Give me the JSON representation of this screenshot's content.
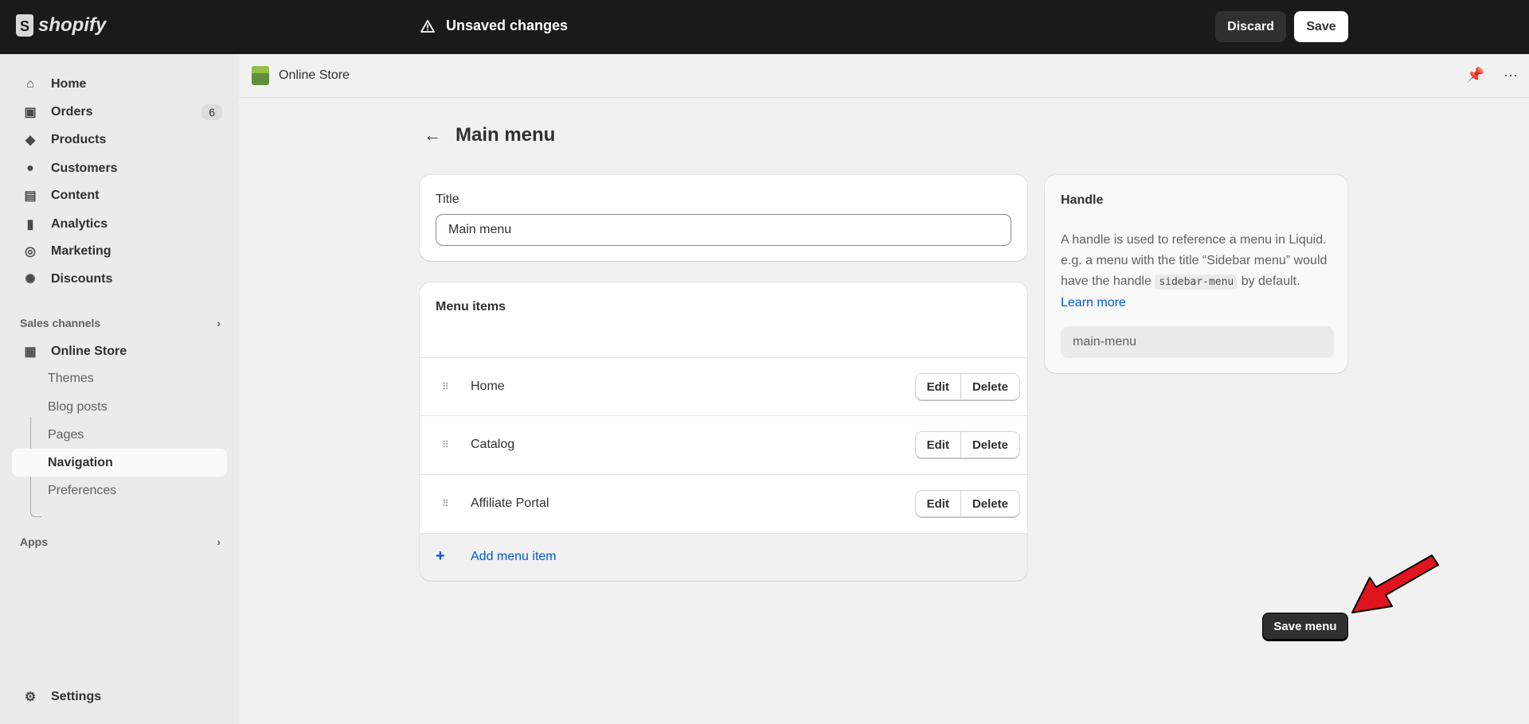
{
  "topbar": {
    "brand": "shopify",
    "status": "Unsaved changes",
    "discard": "Discard",
    "save": "Save"
  },
  "sidebar": {
    "items": [
      {
        "label": "Home",
        "icon": "home-icon"
      },
      {
        "label": "Orders",
        "icon": "orders-icon",
        "badge": "6"
      },
      {
        "label": "Products",
        "icon": "tag-icon"
      },
      {
        "label": "Customers",
        "icon": "person-icon"
      },
      {
        "label": "Content",
        "icon": "content-icon"
      },
      {
        "label": "Analytics",
        "icon": "bar-chart-icon"
      },
      {
        "label": "Marketing",
        "icon": "target-icon"
      },
      {
        "label": "Discounts",
        "icon": "discount-icon"
      }
    ],
    "sales_channels": "Sales channels",
    "online_store": "Online Store",
    "sub_items": [
      "Themes",
      "Blog posts",
      "Pages",
      "Navigation",
      "Preferences"
    ],
    "active_sub": "Navigation",
    "apps": "Apps",
    "settings": "Settings"
  },
  "header": {
    "title": "Online Store"
  },
  "page": {
    "title": "Main menu"
  },
  "title_card": {
    "label": "Title",
    "value": "Main menu"
  },
  "menu_card": {
    "heading": "Menu items",
    "items": [
      "Home",
      "Catalog",
      "Affiliate Portal"
    ],
    "edit": "Edit",
    "delete": "Delete",
    "add": "Add menu item"
  },
  "handle_card": {
    "heading": "Handle",
    "text_before": "A handle is used to reference a menu in Liquid. e.g. a menu with the title “Sidebar menu” would have the handle",
    "code": "sidebar-menu",
    "text_after": "by default.",
    "link": "Learn more",
    "value": "main-menu"
  },
  "save_menu": "Save menu",
  "colors": {
    "topbar": "#1a1a1a",
    "link": "#005bd3",
    "annotation_arrow": "#e0141e"
  }
}
